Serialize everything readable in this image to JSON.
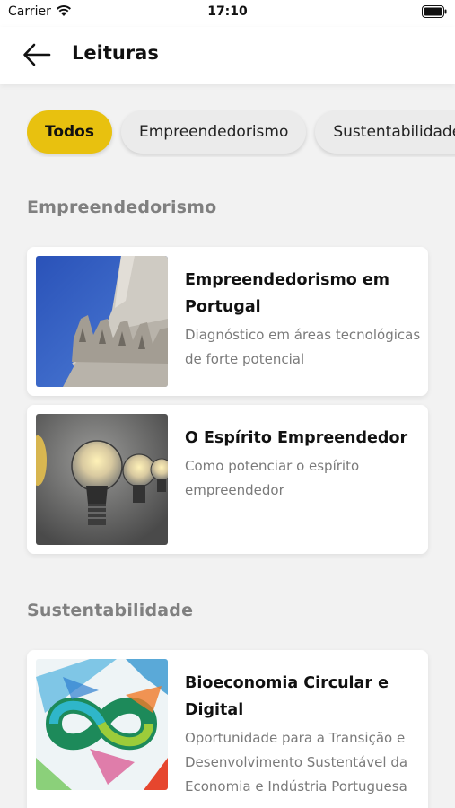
{
  "status_bar": {
    "carrier": "Carrier",
    "time": "17:10"
  },
  "nav": {
    "title": "Leituras"
  },
  "filters": [
    {
      "label": "Todos",
      "active": true
    },
    {
      "label": "Empreendedorismo",
      "active": false
    },
    {
      "label": "Sustentabilidade",
      "active": false
    }
  ],
  "sections": [
    {
      "title": "Empreendedorismo",
      "items": [
        {
          "title": "Empreendedorismo em Portugal",
          "description": "Diagnóstico em áreas tecnológicas de forte potencial"
        },
        {
          "title": "O Espírito Empreendedor",
          "description": "Como potenciar o espírito empreendedor"
        }
      ]
    },
    {
      "title": "Sustentabilidade",
      "items": [
        {
          "title": "Bioeconomia Circular e Digital",
          "description": "Oportunidade para a Transição e Desenvolvimento Sustentável da Economia e Indústria Portuguesa"
        }
      ]
    }
  ],
  "colors": {
    "accent": "#e8c10f",
    "background": "#f2f2f2",
    "card": "#ffffff",
    "muted_text": "#808080"
  }
}
